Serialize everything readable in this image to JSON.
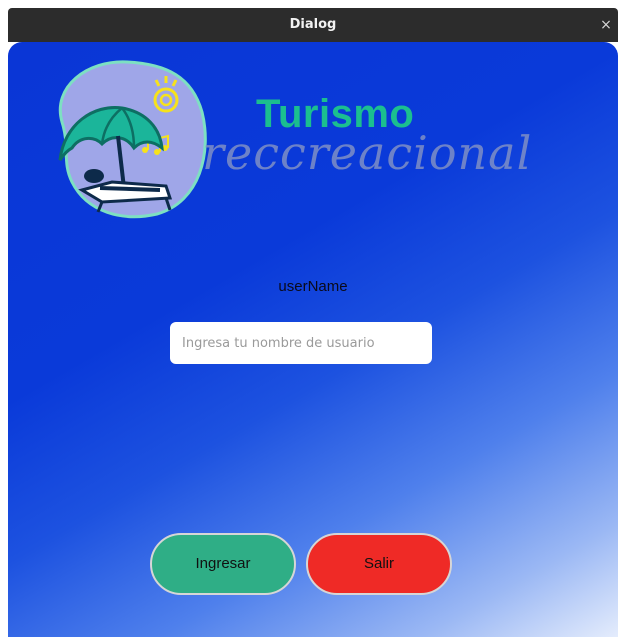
{
  "window": {
    "title": "Dialog",
    "close_glyph": "×"
  },
  "brand": {
    "line1": "Turismo",
    "line2": "reccreacional",
    "logo_icon": "beach-umbrella-icon"
  },
  "form": {
    "user_label": "userName",
    "user_placeholder": "Ingresa tu nombre de usuario",
    "user_value": ""
  },
  "buttons": {
    "ingresar": "Ingresar",
    "salir": "Salir"
  },
  "colors": {
    "titlebar": "#2c2c2c",
    "background_start": "#0a36d6",
    "background_end": "#e4ecfc",
    "brand_green": "#1bbf8f",
    "ingresar_bg": "#2fae86",
    "salir_bg": "#ef2a26"
  }
}
